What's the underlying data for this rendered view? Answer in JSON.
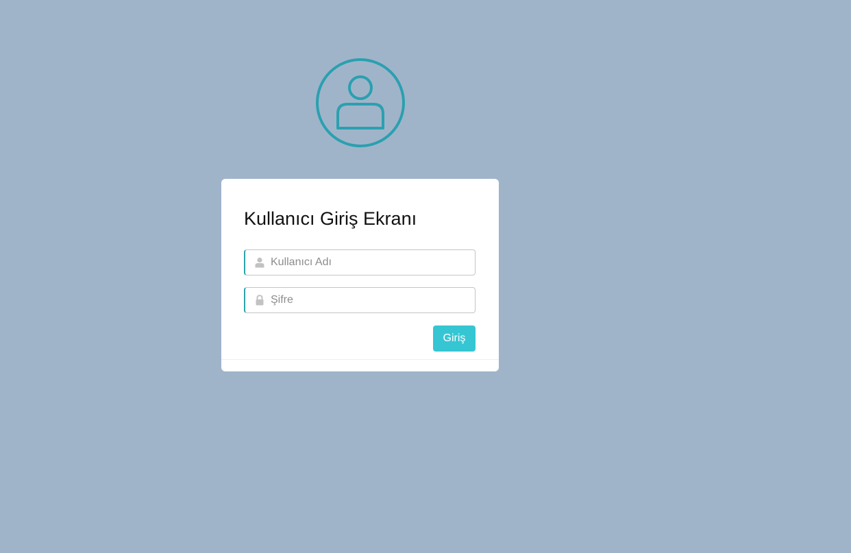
{
  "colors": {
    "page_background": "#a0b4c9",
    "accent": "#2ba3a9",
    "button": "#36c6d3",
    "card": "#ffffff"
  },
  "header": {
    "avatar_icon": "user-circle-icon"
  },
  "login_form": {
    "title": "Kullanıcı Giriş Ekranı",
    "username": {
      "icon": "user-icon",
      "placeholder": "Kullanıcı Adı",
      "value": ""
    },
    "password": {
      "icon": "lock-icon",
      "placeholder": "Şifre",
      "value": ""
    },
    "submit_label": "Giriş"
  }
}
